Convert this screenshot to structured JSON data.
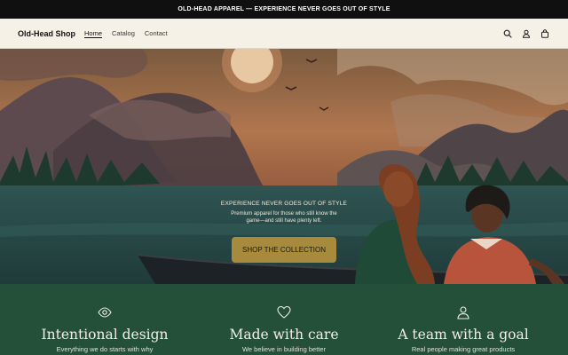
{
  "announcement": "OLD-HEAD APPAREL — EXPERIENCE NEVER GOES OUT OF STYLE",
  "header": {
    "logo": "Old-Head Shop",
    "nav": [
      "Home",
      "Catalog",
      "Contact"
    ],
    "active_nav": "Home",
    "icons": [
      "search-icon",
      "account-icon",
      "cart-icon"
    ]
  },
  "hero": {
    "eyebrow": "EXPERIENCE NEVER GOES OUT OF STYLE",
    "subtitle": "Premium apparel for those who still know the game—and still have plenty left.",
    "cta": "SHOP THE COLLECTION",
    "cta_color": "#a88a3c"
  },
  "features": [
    {
      "icon": "eye-icon",
      "title": "Intentional design",
      "text": "Everything we do starts with why"
    },
    {
      "icon": "heart-icon",
      "title": "Made with care",
      "text": "We believe in building better"
    },
    {
      "icon": "person-icon",
      "title": "A team with a goal",
      "text": "Real people making great products"
    }
  ],
  "colors": {
    "announcement_bg": "#101010",
    "header_bg": "#f6f1e7",
    "features_bg": "#245039"
  }
}
